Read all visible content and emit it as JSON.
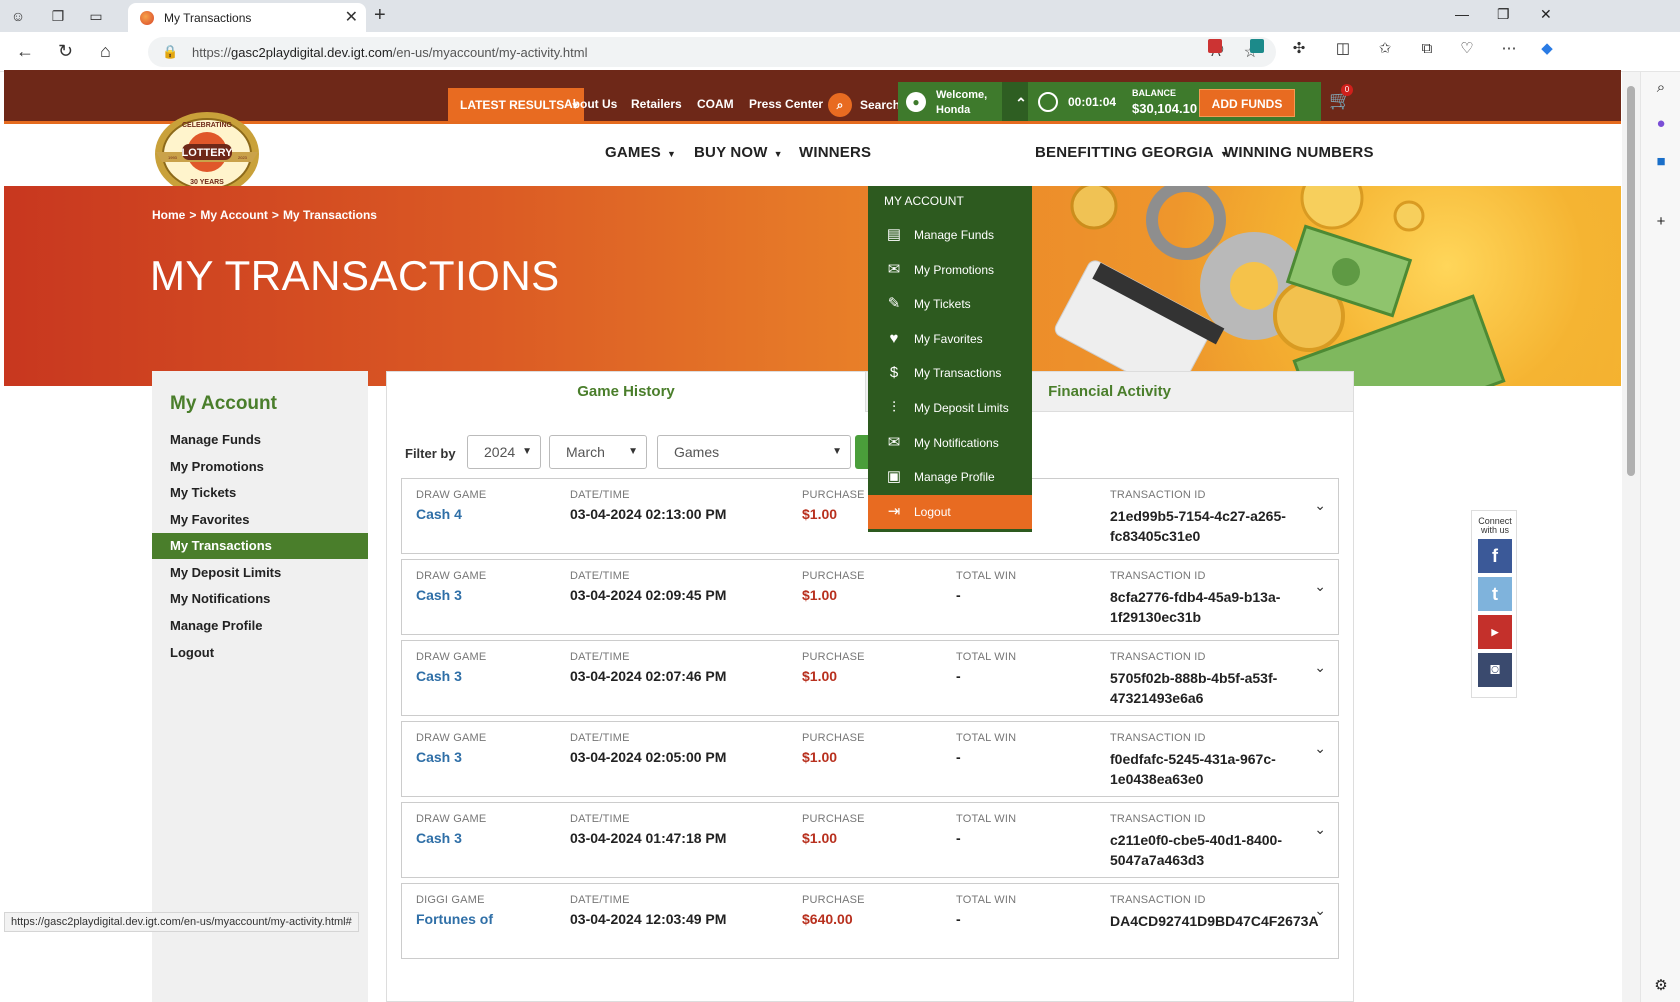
{
  "browser": {
    "tab_title": "My Transactions",
    "url_prefix": "https://",
    "url_host": "gasc2playdigital.dev.igt.com",
    "url_path": "/en-us/myaccount/my-activity.html",
    "status_url": "https://gasc2playdigital.dev.igt.com/en-us/myaccount/my-activity.html#"
  },
  "topbar": {
    "latest_results": "LATEST RESULTS",
    "links": [
      "About Us",
      "Retailers",
      "COAM",
      "Press Center"
    ],
    "search": "Search",
    "welcome_line1": "Welcome,",
    "welcome_line2": "Honda",
    "timer": "00:01:04",
    "balance_label": "BALANCE",
    "balance_value": "$30,104.10",
    "add_funds": "ADD FUNDS",
    "cart_count": "0"
  },
  "mainnav": {
    "items": [
      "GAMES",
      "BUY NOW",
      "WINNERS",
      "BENEFITTING GEORGIA",
      "WINNING NUMBERS"
    ]
  },
  "logo": {
    "top": "CELEBRATING",
    "middle": "LOTTERY",
    "bottom": "30 YEARS",
    "year_left": "1993",
    "year_right": "2023"
  },
  "hero": {
    "crumbs": [
      "Home",
      "My Account",
      "My Transactions"
    ],
    "title": "MY TRANSACTIONS"
  },
  "sidebar": {
    "title": "My Account",
    "items": [
      "Manage Funds",
      "My Promotions",
      "My Tickets",
      "My Favorites",
      "My Transactions",
      "My Deposit Limits",
      "My Notifications",
      "Manage Profile",
      "Logout"
    ],
    "active": "My Transactions"
  },
  "tabs": {
    "game_history": "Game History",
    "financial_activity": "Financial Activity"
  },
  "filter": {
    "label": "Filter by",
    "year": "2024",
    "month": "March",
    "type": "Games"
  },
  "account_menu": {
    "header": "MY ACCOUNT",
    "items": [
      {
        "label": "Manage Funds",
        "icon": "wallet-icon"
      },
      {
        "label": "My Promotions",
        "icon": "promotions-icon"
      },
      {
        "label": "My Tickets",
        "icon": "ticket-icon"
      },
      {
        "label": "My Favorites",
        "icon": "heart-icon"
      },
      {
        "label": "My Transactions",
        "icon": "transactions-icon"
      },
      {
        "label": "My Deposit Limits",
        "icon": "sliders-icon"
      },
      {
        "label": "My Notifications",
        "icon": "envelope-icon"
      },
      {
        "label": "Manage Profile",
        "icon": "profile-card-icon"
      },
      {
        "label": "Logout",
        "icon": "logout-icon"
      }
    ]
  },
  "columns": {
    "date": "DATE/TIME",
    "purchase": "PURCHASE",
    "win": "TOTAL WIN",
    "txid": "TRANSACTION ID"
  },
  "transactions": [
    {
      "type": "DRAW GAME",
      "game": "Cash 4",
      "date": "03-04-2024 02:13:00 PM",
      "purchase": "$1.00",
      "win": "-",
      "txid": "21ed99b5-7154-4c27-a265-fc83405c31e0"
    },
    {
      "type": "DRAW GAME",
      "game": "Cash 3",
      "date": "03-04-2024 02:09:45 PM",
      "purchase": "$1.00",
      "win": "-",
      "txid": "8cfa2776-fdb4-45a9-b13a-1f29130ec31b"
    },
    {
      "type": "DRAW GAME",
      "game": "Cash 3",
      "date": "03-04-2024 02:07:46 PM",
      "purchase": "$1.00",
      "win": "-",
      "txid": "5705f02b-888b-4b5f-a53f-47321493e6a6"
    },
    {
      "type": "DRAW GAME",
      "game": "Cash 3",
      "date": "03-04-2024 02:05:00 PM",
      "purchase": "$1.00",
      "win": "-",
      "txid": "f0edfafc-5245-431a-967c-1e0438ea63e0"
    },
    {
      "type": "DRAW GAME",
      "game": "Cash 3",
      "date": "03-04-2024 01:47:18 PM",
      "purchase": "$1.00",
      "win": "-",
      "txid": "c211e0f0-cbe5-40d1-8400-5047a7a463d3"
    },
    {
      "type": "DIGGI GAME",
      "game": "Fortunes of",
      "date": "03-04-2024 12:03:49 PM",
      "purchase": "$640.00",
      "win": "-",
      "txid": "DA4CD92741D9BD47C4F2673A"
    }
  ],
  "social": {
    "label": "Connect with us",
    "items": [
      "facebook-icon",
      "twitter-icon",
      "youtube-icon",
      "instagram-icon"
    ]
  },
  "colors": {
    "brand_green": "#4a7e2b",
    "brand_orange": "#e86b21",
    "header_maroon": "#6e2818",
    "price_red": "#b8301e",
    "link_blue": "#2f6fa7"
  }
}
